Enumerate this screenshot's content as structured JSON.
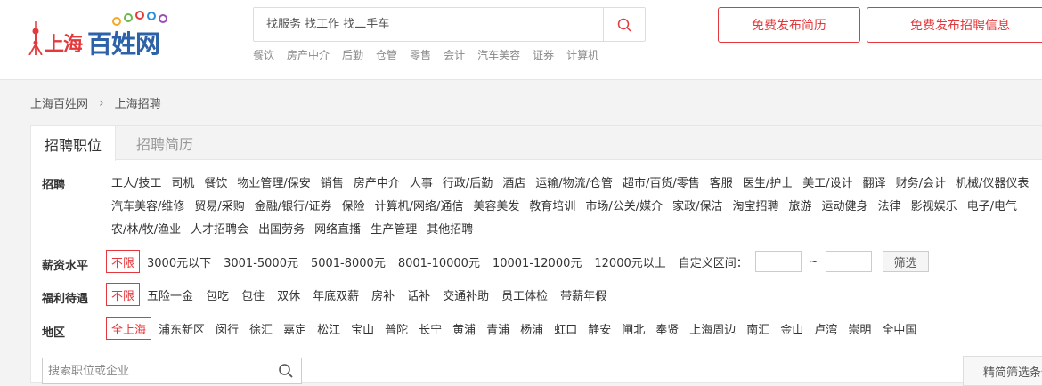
{
  "logo": {
    "city": "上海",
    "brand": "百姓网"
  },
  "search": {
    "placeholder": "找服务 找工作 找二手车"
  },
  "hotwords": [
    "餐饮",
    "房产中介",
    "后勤",
    "仓管",
    "零售",
    "会计",
    "汽车美容",
    "证券",
    "计算机"
  ],
  "header_buttons": {
    "resume": "免费发布简历",
    "job": "免费发布招聘信息"
  },
  "breadcrumb": {
    "home": "上海百姓网",
    "sep": "›",
    "current": "上海招聘"
  },
  "tabs": {
    "active": "招聘职位",
    "inactive": "招聘简历"
  },
  "categories": {
    "label": "招聘",
    "items": [
      "工人/技工",
      "司机",
      "餐饮",
      "物业管理/保安",
      "销售",
      "房产中介",
      "人事",
      "行政/后勤",
      "酒店",
      "运输/物流/仓管",
      "超市/百货/零售",
      "客服",
      "医生/护士",
      "美工/设计",
      "翻译",
      "财务/会计",
      "机械/仪器仪表",
      "汽车美容/维修",
      "贸易/采购",
      "金融/银行/证券",
      "保险",
      "计算机/网络/通信",
      "美容美发",
      "教育培训",
      "市场/公关/媒介",
      "家政/保洁",
      "淘宝招聘",
      "旅游",
      "运动健身",
      "法律",
      "影视娱乐",
      "电子/电气",
      "农/林/牧/渔业",
      "人才招聘会",
      "出国劳务",
      "网络直播",
      "生产管理",
      "其他招聘"
    ]
  },
  "salary": {
    "label": "薪资水平",
    "selected": "不限",
    "options": [
      "3000元以下",
      "3001-5000元",
      "5001-8000元",
      "8001-10000元",
      "10001-12000元",
      "12000元以上"
    ],
    "custom_label": "自定义区间：",
    "tilde": "~",
    "filter_button": "筛选"
  },
  "benefits": {
    "label": "福利待遇",
    "selected": "不限",
    "options": [
      "五险一金",
      "包吃",
      "包住",
      "双休",
      "年底双薪",
      "房补",
      "话补",
      "交通补助",
      "员工体检",
      "带薪年假"
    ]
  },
  "region": {
    "label": "地区",
    "selected": "全上海",
    "options": [
      "浦东新区",
      "闵行",
      "徐汇",
      "嘉定",
      "松江",
      "宝山",
      "普陀",
      "长宁",
      "黄浦",
      "青浦",
      "杨浦",
      "虹口",
      "静安",
      "闸北",
      "奉贤",
      "上海周边",
      "南汇",
      "金山",
      "卢湾",
      "崇明",
      "全中国"
    ]
  },
  "keyword": {
    "placeholder": "搜索职位或企业"
  },
  "refine_button": "精简筛选条件",
  "colors": {
    "accent": "#e4393c",
    "brand_blue": "#2d62a8"
  }
}
